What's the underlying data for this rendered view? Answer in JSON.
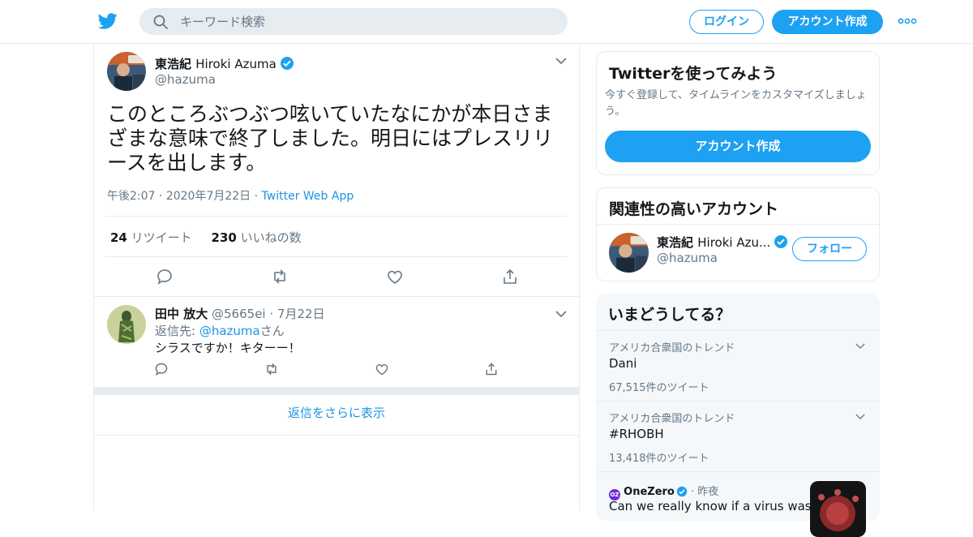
{
  "header": {
    "search_placeholder": "キーワード検索",
    "login_label": "ログイン",
    "signup_label": "アカウント作成"
  },
  "tweet": {
    "author_name": "東浩紀",
    "author_name_en": "Hiroki Azuma",
    "author_handle": "@hazuma",
    "text": "このところぶつぶつ呟いていたなにかが本日さまざまな意味で終了しました。明日にはプレスリリースを出します。",
    "time": "午後2:07",
    "date": "2020年7月22日",
    "app": "Twitter Web App",
    "retweet_count": "24",
    "retweet_label": "リツイート",
    "like_count": "230",
    "like_label": "いいねの数"
  },
  "reply": {
    "author_name": "田中 放大",
    "author_handle": "@5665ei",
    "date": "7月22日",
    "reply_to_prefix": "返信先: ",
    "reply_to_handle": "@hazuma",
    "reply_to_suffix": "さん",
    "text": "シラスですか！キターー！"
  },
  "show_more_replies": "返信をさらに表示",
  "signup_card": {
    "title": "Twitterを使ってみよう",
    "subtitle": "今すぐ登録して、タイムラインをカスタマイズしましょう。",
    "button": "アカウント作成"
  },
  "related_card": {
    "title": "関連性の高いアカウント",
    "name": "東浩紀",
    "name_en": "Hiroki Azu...",
    "handle": "@hazuma",
    "follow_label": "フォロー"
  },
  "trends_card": {
    "title": "いまどうしてる？",
    "items": [
      {
        "location": "アメリカ合衆国のトレンド",
        "topic": "Dani",
        "count": "67,515件のツイート"
      },
      {
        "location": "アメリカ合衆国のトレンド",
        "topic": "#RHOBH",
        "count": "13,418件のツイート"
      }
    ],
    "news": {
      "source": "OneZero",
      "time": "昨夜",
      "headline": "Can we really know if a virus was"
    }
  },
  "colors": {
    "accent": "#1da1f2",
    "link": "#1b95e0",
    "muted": "#657786",
    "border": "#e6ecf0"
  }
}
